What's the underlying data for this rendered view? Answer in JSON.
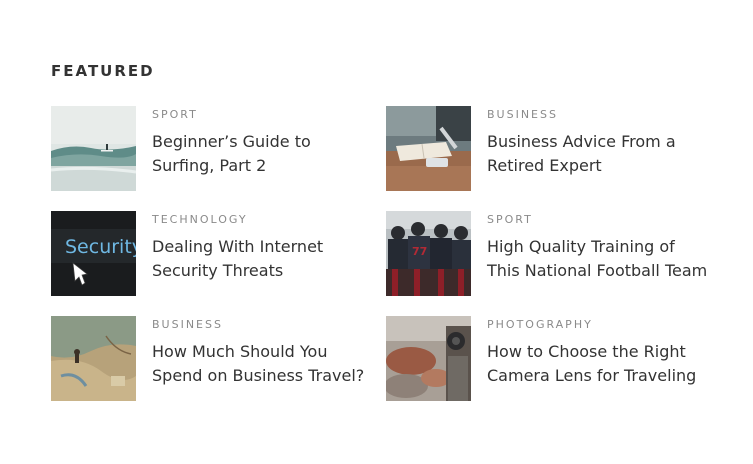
{
  "section": {
    "title": "FEATURED"
  },
  "posts": [
    {
      "category": "SPORT",
      "title": "Beginner’s Guide to Surfing, Part 2",
      "image": "surfing-photo"
    },
    {
      "category": "BUSINESS",
      "title": "Business Advice From a Retired Expert",
      "image": "desk-notebook-photo"
    },
    {
      "category": "TECHNOLOGY",
      "title": "Dealing With Internet Security Threats",
      "image": "security-screen-photo",
      "image_text": "Security"
    },
    {
      "category": "SPORT",
      "title": "High Quality Training of This National Football Team",
      "image": "football-team-photo",
      "image_text": "77"
    },
    {
      "category": "BUSINESS",
      "title": "How Much Should You Spend on Business Travel?",
      "image": "map-travel-photo"
    },
    {
      "category": "PHOTOGRAPHY",
      "title": "How to Choose the Right Camera Lens for Traveling",
      "image": "photographer-rocks-photo"
    }
  ]
}
